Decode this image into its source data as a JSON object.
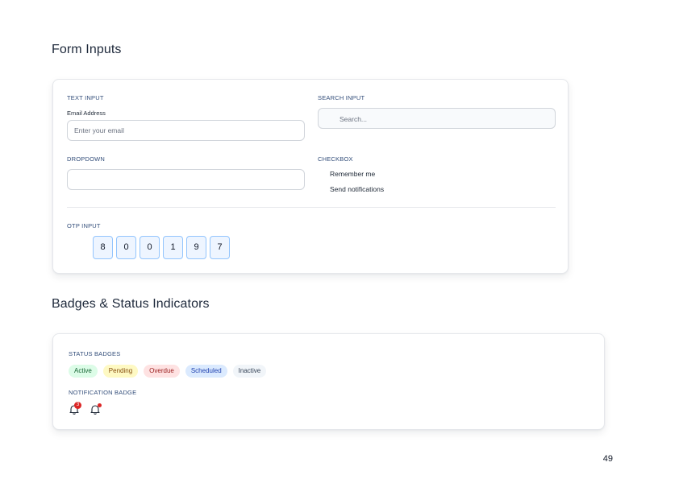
{
  "form_inputs": {
    "title": "Form Inputs",
    "text_input": {
      "section_label": "TEXT INPUT",
      "field_label": "Email Address",
      "placeholder": "Enter your email",
      "value": ""
    },
    "search_input": {
      "section_label": "SEARCH INPUT",
      "placeholder": "Search...",
      "value": "",
      "icon": "search-icon"
    },
    "dropdown": {
      "section_label": "DROPDOWN",
      "selected": ""
    },
    "checkbox": {
      "section_label": "CHECKBOX",
      "items": [
        {
          "label": "Remember me"
        },
        {
          "label": "Send notifications"
        }
      ]
    },
    "otp": {
      "section_label": "OTP INPUT",
      "digits": [
        "8",
        "0",
        "0",
        "1",
        "9",
        "7"
      ]
    }
  },
  "badges": {
    "title": "Badges & Status Indicators",
    "status_badges": {
      "section_label": "STATUS BADGES",
      "items": [
        {
          "label": "Active",
          "color": "#166534",
          "bg": "#dcfce7"
        },
        {
          "label": "Pending",
          "color": "#854d0e",
          "bg": "#fef9c3"
        },
        {
          "label": "Overdue",
          "color": "#991b1b",
          "bg": "#fee2e2"
        },
        {
          "label": "Scheduled",
          "color": "#1e40af",
          "bg": "#dbeafe"
        },
        {
          "label": "Inactive",
          "color": "#334155",
          "bg": "#f1f5f9"
        }
      ]
    },
    "notification_badge": {
      "section_label": "NOTIFICATION BADGE",
      "bell_count": "3",
      "icon": "bell-icon",
      "indicator_color": "#dc2626"
    }
  },
  "page_number": "49"
}
